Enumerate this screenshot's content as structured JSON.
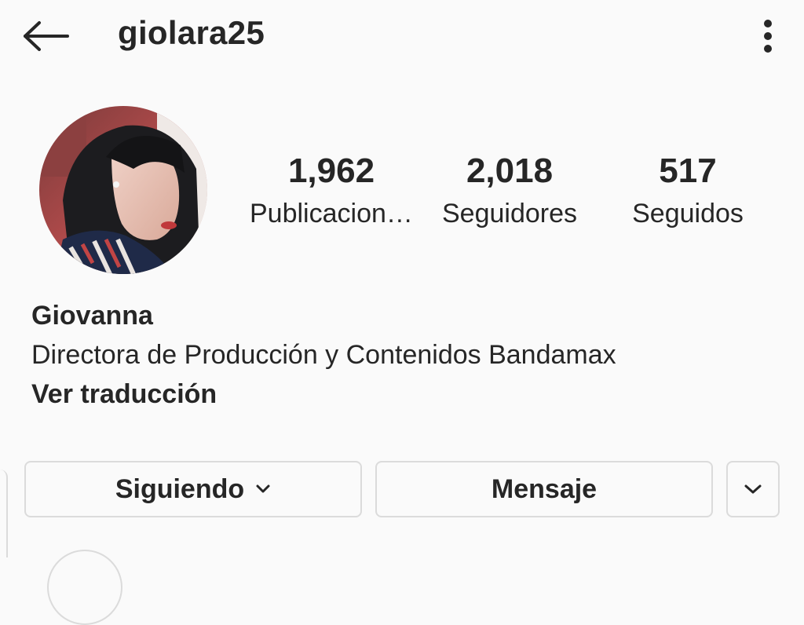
{
  "header": {
    "username": "giolara25",
    "back_icon": "arrow-left-icon",
    "more_icon": "more-vertical-icon"
  },
  "profile": {
    "avatar_alt": "profile photo",
    "stats": {
      "posts_count": "1,962",
      "posts_label": "Publicaciones",
      "followers_count": "2,018",
      "followers_label": "Seguidores",
      "following_count": "517",
      "following_label": "Seguidos"
    },
    "name": "Giovanna",
    "bio": "Directora de Producción y Contenidos Bandamax",
    "translate_label": "Ver traducción"
  },
  "actions": {
    "following_label": "Siguiendo",
    "following_icon": "chevron-down-icon",
    "message_label": "Mensaje",
    "suggested_icon": "chevron-down-icon"
  },
  "colors": {
    "background": "#fafafa",
    "text": "#262626",
    "border": "#dbdbdb"
  }
}
